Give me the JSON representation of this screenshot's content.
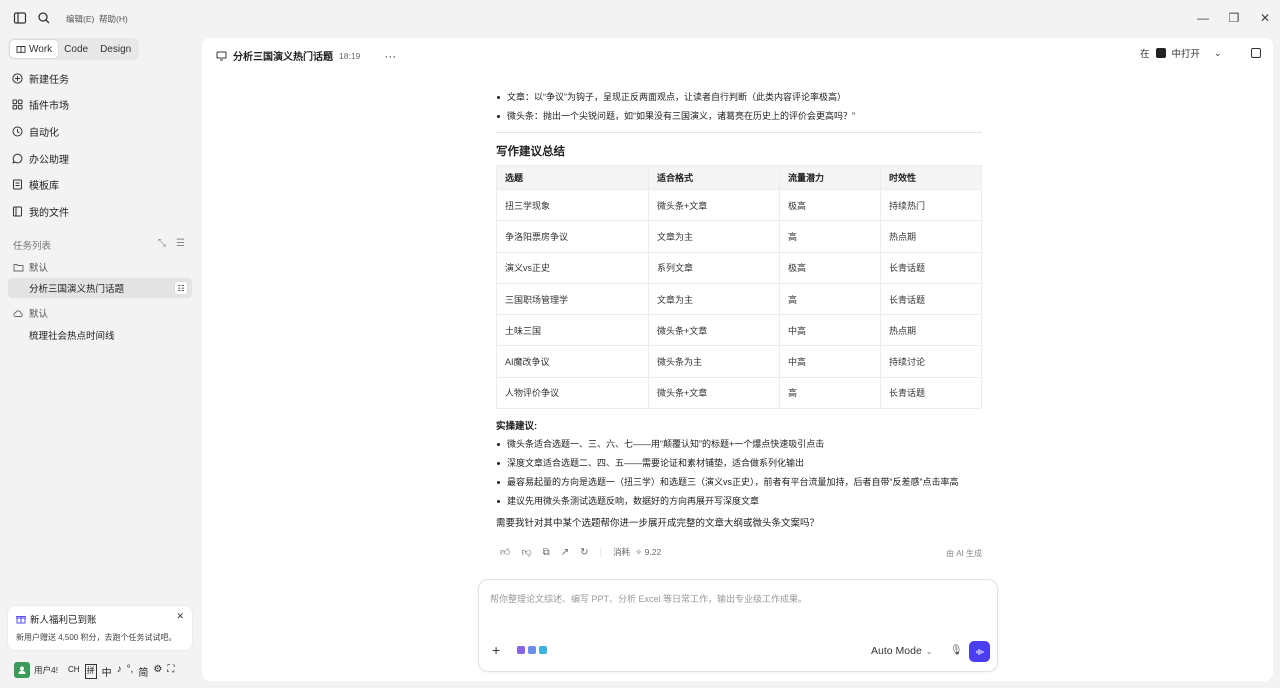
{
  "titlebar": {
    "menu_edit": "编辑(E)",
    "menu_help": "帮助(H)"
  },
  "modes": [
    "Work",
    "Code",
    "Design"
  ],
  "nav": [
    {
      "label": "新建任务",
      "icon": "plus-circle-icon"
    },
    {
      "label": "插件市场",
      "icon": "grid-icon"
    },
    {
      "label": "自动化",
      "icon": "clock-icon"
    },
    {
      "label": "办公助理",
      "icon": "chat-icon"
    },
    {
      "label": "模板库",
      "icon": "template-icon"
    },
    {
      "label": "我的文件",
      "icon": "folder-icon"
    }
  ],
  "tasks": {
    "section_label": "任务列表",
    "group1": "默认",
    "task1": "分析三国演义热门话题",
    "group2": "默认",
    "task2": "梳理社会热点时间线"
  },
  "promo": {
    "title": "新人福利已到账",
    "desc": "新用户赠送 4,500 积分，去跑个任务试试吧。"
  },
  "user": {
    "name": "用户4!",
    "ime": [
      "CH",
      "拼",
      "中",
      "♪",
      "°,",
      "简",
      "⚙",
      "⛶"
    ]
  },
  "header": {
    "title": "分析三国演义热门话题",
    "time": "18:19",
    "open_prefix": "在",
    "open_label": "中打开"
  },
  "content": {
    "top_bullets": [
      "文章：以“争议”为钩子，呈现正反两面观点，让读者自行判断（此类内容评论率极高）",
      "微头条：抛出一个尖锐问题，如“如果没有三国演义，诸葛亮在历史上的评价会更高吗？”"
    ],
    "section_title": "写作建议总结",
    "table": {
      "headers": [
        "选题",
        "适合格式",
        "流量潜力",
        "时效性"
      ],
      "rows": [
        [
          "扭三学现象",
          "微头条+文章",
          "极高",
          "持续热门"
        ],
        [
          "争洛阳票房争议",
          "文章为主",
          "高",
          "热点期"
        ],
        [
          "演义vs正史",
          "系列文章",
          "极高",
          "长青话题"
        ],
        [
          "三国职场管理学",
          "文章为主",
          "高",
          "长青话题"
        ],
        [
          "土味三国",
          "微头条+文章",
          "中高",
          "热点期"
        ],
        [
          "AI魔改争议",
          "微头条为主",
          "中高",
          "持续讨论"
        ],
        [
          "人物评价争议",
          "微头条+文章",
          "高",
          "长青话题"
        ]
      ]
    },
    "practice_title": "实操建议:",
    "practice_bullets": [
      "微头条适合选题一、三、六、七——用“颠覆认知”的标题+一个爆点快速吸引点击",
      "深度文章适合选题二、四、五——需要论证和素材铺垫，适合做系列化输出",
      "最容易起量的方向是选题一（扭三学）和选题三（演义vs正史），前者有平台流量加持，后者自带“反差感”点击率高",
      "建议先用微头条测试选题反响，数据好的方向再展开写深度文章"
    ],
    "closing": "需要我针对其中某个选题帮你进一步展开成完整的文章大纲或微头条文案吗？"
  },
  "actions": {
    "consumed_label": "消耗",
    "consumed_value": "9.22",
    "ai_generated": "由 AI 生成"
  },
  "composer": {
    "placeholder": "帮你整理论文综述、编写 PPT、分析 Excel 等日常工作，输出专业级工作成果。",
    "mode": "Auto Mode"
  }
}
